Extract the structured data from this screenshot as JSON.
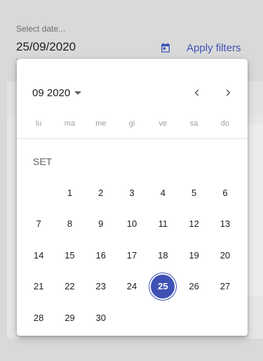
{
  "filter": {
    "date_label": "Select date...",
    "date_value": "25/09/2020",
    "apply_label": "Apply filters",
    "accent_color": "#3f51b5"
  },
  "calendar": {
    "period": "09 2020",
    "weekdays": [
      "lu",
      "ma",
      "me",
      "gi",
      "ve",
      "sa",
      "do"
    ],
    "month_label": "SET",
    "first_day_offset": 1,
    "days": [
      "1",
      "2",
      "3",
      "4",
      "5",
      "6",
      "7",
      "8",
      "9",
      "10",
      "11",
      "12",
      "13",
      "14",
      "15",
      "16",
      "17",
      "18",
      "19",
      "20",
      "21",
      "22",
      "23",
      "24",
      "25",
      "26",
      "27",
      "28",
      "29",
      "30"
    ],
    "selected_day": "25",
    "icons": {
      "prev": "chevron-left-icon",
      "next": "chevron-right-icon",
      "period_toggle": "caret-down-icon",
      "date_picker": "calendar-icon"
    }
  }
}
